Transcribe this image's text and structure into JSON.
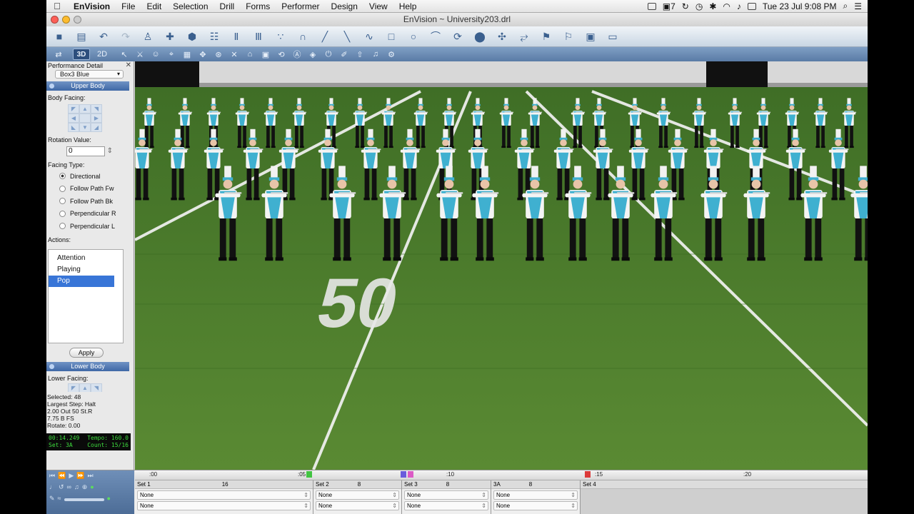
{
  "menubar": {
    "app": "EnVision",
    "items": [
      "File",
      "Edit",
      "Selection",
      "Drill",
      "Forms",
      "Performer",
      "Design",
      "View",
      "Help"
    ],
    "status_number": "7",
    "clock": "Tue 23 Jul  9:08 PM"
  },
  "window": {
    "title": "EnVision ~ University203.drl"
  },
  "toolbar": {
    "mode_3d": "3D",
    "mode_2d": "2D"
  },
  "panel": {
    "title": "Performance Detail",
    "group_select": "Box3 Blue",
    "upper_body": "Upper Body",
    "body_facing": "Body Facing:",
    "rotation_label": "Rotation Value:",
    "rotation_value": "0",
    "facing_type_label": "Facing Type:",
    "facing_types": [
      "Directional",
      "Follow Path Fw",
      "Follow Path Bk",
      "Perpendicular R",
      "Perpendicular L"
    ],
    "facing_selected": 0,
    "actions_label": "Actions:",
    "actions": [
      "Attention",
      "Playing",
      "Pop"
    ],
    "action_selected": 2,
    "apply": "Apply",
    "lower_body": "Lower Body",
    "lower_facing": "Lower Facing:",
    "stats": [
      "Selected: 48",
      "Largest Step: Halt",
      "2.00 Out 50 St.R",
      "7.75 B FS",
      "Rotate: 0.00"
    ],
    "lcd": {
      "time": "00:14.249",
      "tempo": "Tempo: 160.0",
      "set": "Set: 3A",
      "count": "Count: 15/16"
    }
  },
  "field": {
    "yard_number": "50"
  },
  "timeline": {
    "ruler_labels": [
      ":00",
      ":05",
      ":10",
      ":15",
      ":20"
    ],
    "sets": [
      {
        "name": "Set 1",
        "tick": "16",
        "rows": [
          "None",
          "None"
        ]
      },
      {
        "name": "Set 2",
        "tick": "8",
        "rows": [
          "None",
          "None"
        ]
      },
      {
        "name": "Set 3",
        "tick": "8",
        "rows": [
          "None",
          "None"
        ]
      },
      {
        "name": "3A",
        "tick": "8",
        "rows": [
          "None",
          "None"
        ]
      },
      {
        "name": "Set 4",
        "tick": "",
        "rows": []
      }
    ]
  },
  "colors": {
    "accent": "#3875d7",
    "uniform_blue": "#3fb0d0",
    "turf": "#4d7c2e"
  }
}
